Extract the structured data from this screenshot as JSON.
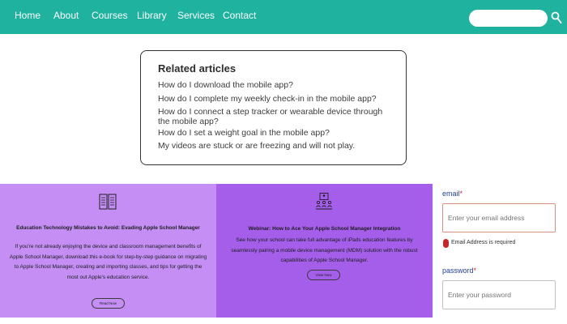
{
  "nav": {
    "items": [
      "Home",
      "About",
      "Courses",
      "Library",
      "Services",
      "Contact"
    ]
  },
  "search": {
    "placeholder": ""
  },
  "related": {
    "title": "Related articles",
    "links": [
      "How do I download the mobile app?",
      "How do I complete my weekly check-in in the mobile app?",
      "How do I connect a step tracker or wearable device through the mobile app?",
      "How do I set a weight goal in the mobile app?",
      "My videos are stuck or are freezing and will not play."
    ]
  },
  "panels": [
    {
      "icon": "book-icon",
      "title": "Education Technology Mistakes to Avoid: Evading Apple School Manager",
      "body": "If you're not already enjoying the device and classroom management benefits of Apple School Manager, download this e-book for step-by-step guidance on migrating to Apple School Manager, creating and importing classes, and tips for getting the most out Apple's education service.",
      "button": "Read Now"
    },
    {
      "icon": "webinar-icon",
      "title": "Webinar: How to Ace Your Apple School Manager Integration",
      "body": "See how your school can take full advantage of iPads education features by seamlessly pairing a mobile device management (MDM) solution with the robust capabilities of Apple School Manager.",
      "button": "View Now"
    }
  ],
  "form": {
    "email_label": "email",
    "email_required": "*",
    "email_placeholder": "Enter your email address",
    "email_error": "Email Address is required",
    "password_label": "password",
    "password_required": "*",
    "password_placeholder": "Enter your password"
  },
  "colors": {
    "nav": "#1fb29f",
    "panel_left": "#c48ef5",
    "panel_right": "#a45eea",
    "error": "#c62828",
    "label": "#22409a"
  }
}
